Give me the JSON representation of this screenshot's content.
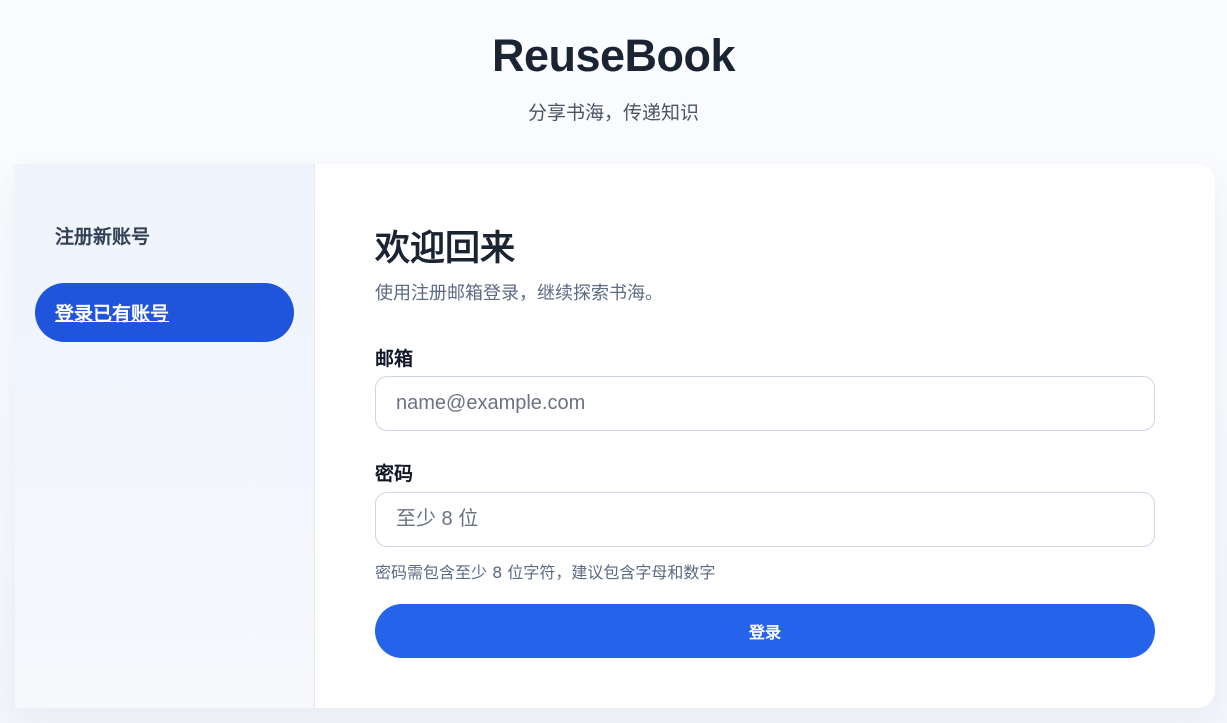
{
  "header": {
    "brand": "ReuseBook",
    "tagline": "分享书海，传递知识"
  },
  "sidebar": {
    "items": [
      {
        "label": "注册新账号",
        "active": false
      },
      {
        "label": "登录已有账号",
        "active": true
      }
    ]
  },
  "form": {
    "title": "欢迎回来",
    "subtitle": "使用注册邮箱登录，继续探索书海。",
    "email_label": "邮箱",
    "email_value": "",
    "email_placeholder": "name@example.com",
    "password_label": "密码",
    "password_value": "",
    "password_placeholder": "至少 8 位",
    "password_hint": "密码需包含至少 8 位字符，建议包含字母和数字",
    "submit_label": "登录"
  },
  "colors": {
    "primary": "#2563eb",
    "active_nav": "#1f54dc",
    "text_dark": "#1b2433",
    "text_muted": "#5b6b84"
  }
}
